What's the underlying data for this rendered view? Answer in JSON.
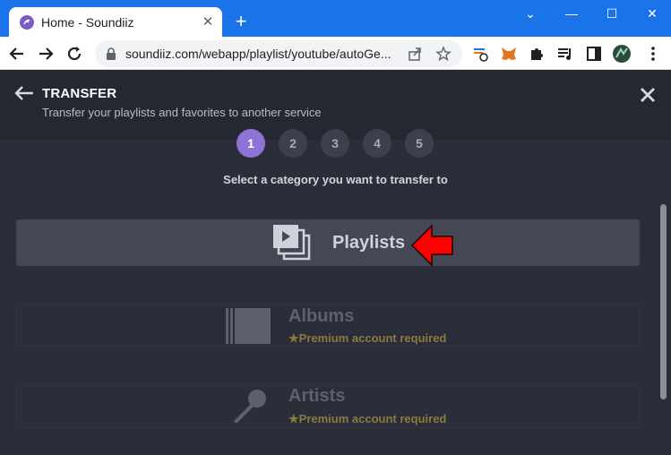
{
  "browser": {
    "tab_title": "Home - Soundiiz",
    "tab_close": "✕",
    "new_tab": "+",
    "url": "soundiiz.com/webapp/playlist/youtube/autoGe...",
    "window_controls": [
      "⌄",
      "—",
      "☐",
      "✕"
    ]
  },
  "header": {
    "title": "TRANSFER",
    "subtitle": "Transfer your playlists and favorites to another service"
  },
  "steps": [
    "1",
    "2",
    "3",
    "4",
    "5"
  ],
  "active_step": "1",
  "instruction": "Select a category you want to transfer to",
  "categories": {
    "playlists": {
      "label": "Playlists"
    },
    "albums": {
      "label": "Albums",
      "premium": "Premium account required"
    },
    "artists": {
      "label": "Artists",
      "premium": "Premium account required"
    }
  },
  "colors": {
    "tabbar": "#1a73e8",
    "page_bg": "#2b2d38",
    "accent_step": "#8e73d4",
    "premium": "#8a7a3f",
    "annotation_arrow": "#ff0000"
  }
}
